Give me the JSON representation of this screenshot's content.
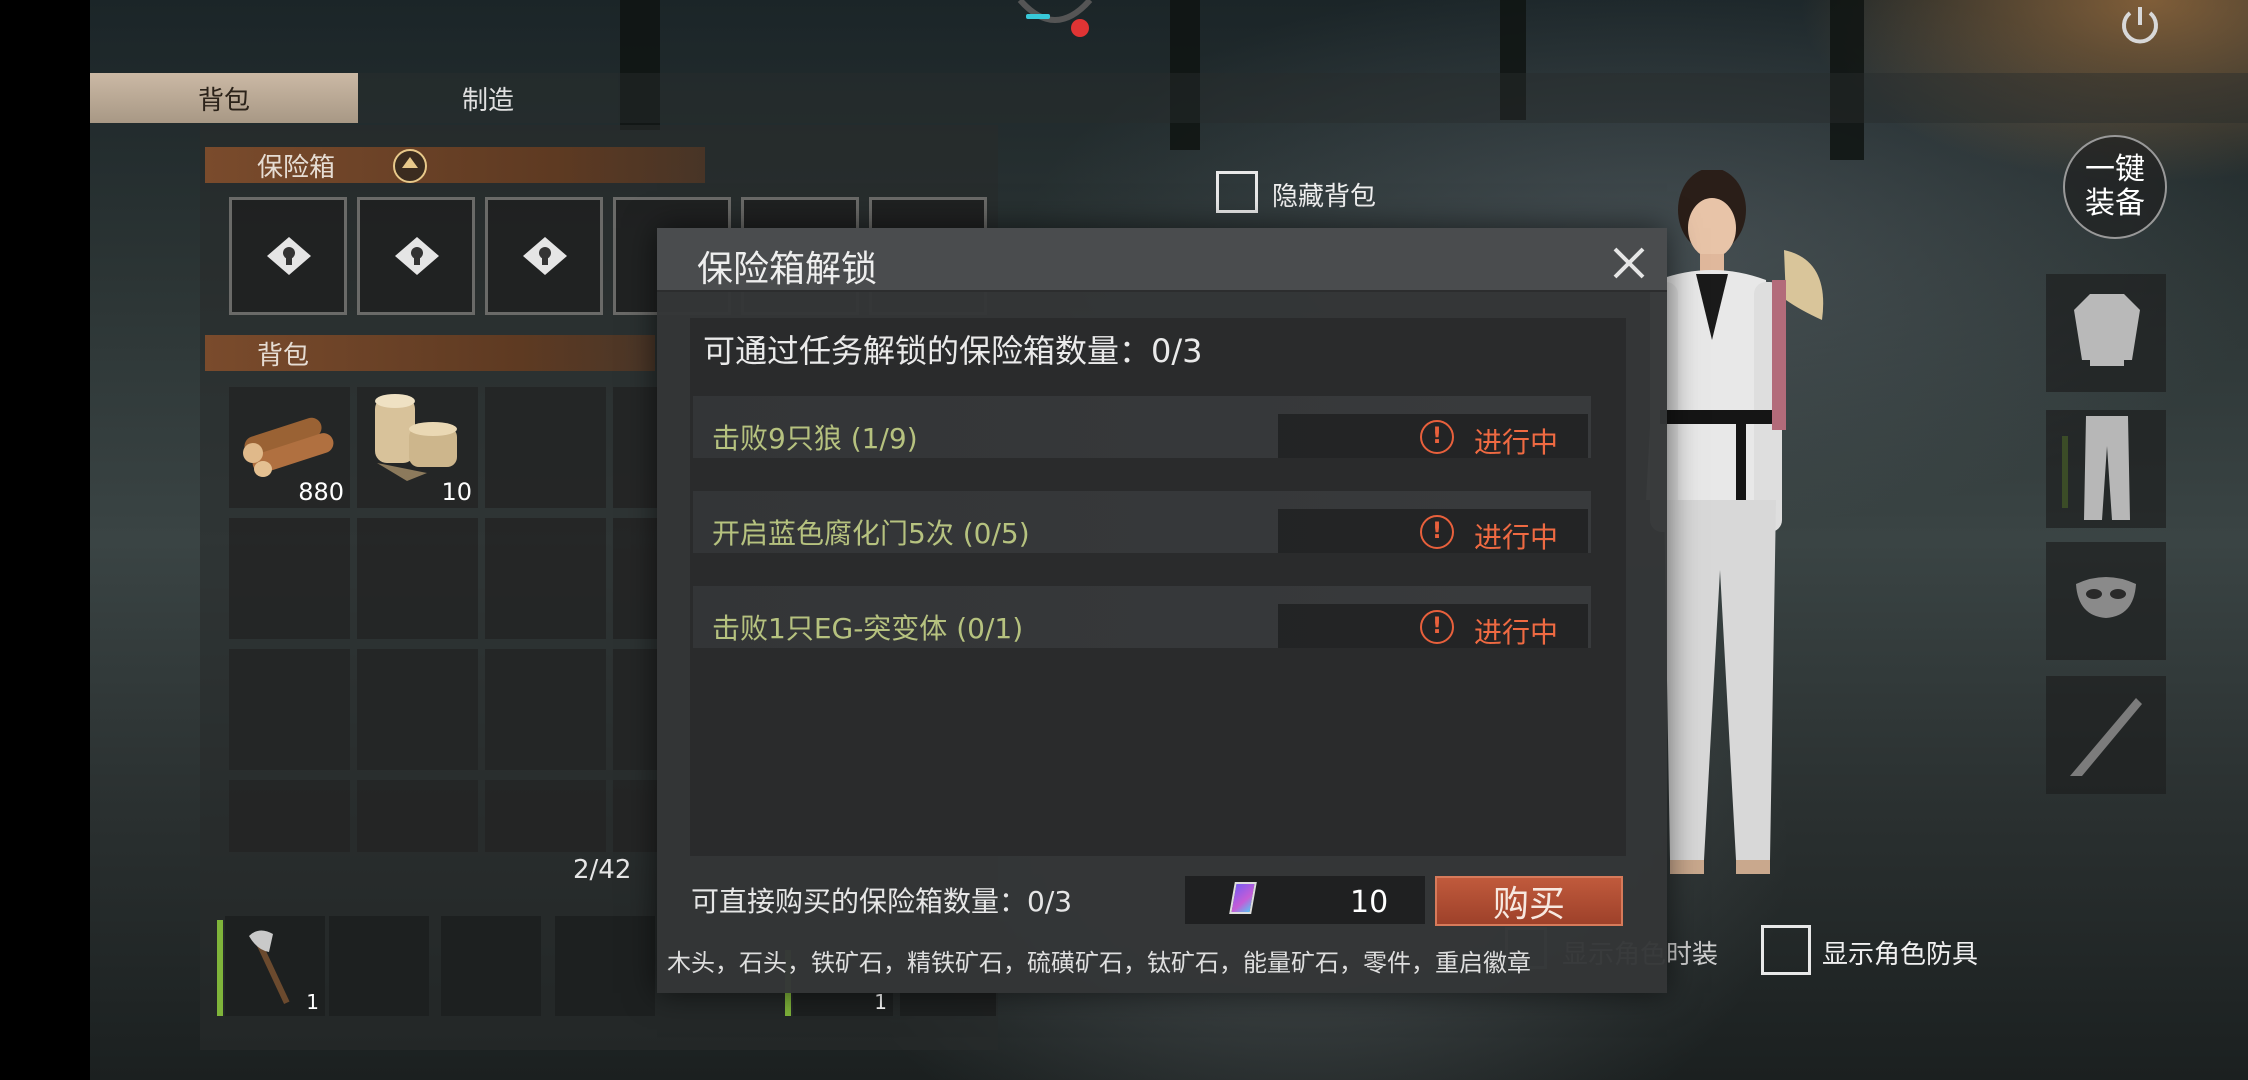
{
  "tabs": {
    "bag": "背包",
    "craft": "制造"
  },
  "left_panel": {
    "safebox_section": "保险箱",
    "bag_section": "背包",
    "items": [
      {
        "icon": "wood-logs-icon",
        "count": "880"
      },
      {
        "icon": "bandage-roll-icon",
        "count": "10"
      }
    ],
    "capacity": "2/42",
    "hotbar": [
      {
        "icon": "axe-icon",
        "count": "1"
      },
      {
        "icon": "item-icon",
        "count": "1"
      }
    ]
  },
  "hide_backpack": {
    "label": "隐藏背包"
  },
  "one_key_equip": {
    "line1": "一键",
    "line2": "装备"
  },
  "show_costume": {
    "label": "显示角色时装"
  },
  "show_armor": {
    "label": "显示角色防具"
  },
  "modal": {
    "title": "保险箱解锁",
    "quest_unlock_count": "可通过任务解锁的保险箱数量：0/3",
    "tasks": [
      {
        "name": "击败9只狼 (1/9)",
        "status": "进行中",
        "progress": 0.111
      },
      {
        "name": "开启蓝色腐化门5次 (0/5)",
        "status": "进行中",
        "progress": 0
      },
      {
        "name": "击败1只EG-突变体 (0/1)",
        "status": "进行中",
        "progress": 0
      }
    ],
    "buy_count": "可直接购买的保险箱数量：0/3",
    "price": "10",
    "buy_button": "购买",
    "materials": "木头，石头，铁矿石，精铁矿石，硫磺矿石，钛矿石，能量矿石，零件，重启徽章"
  },
  "colors": {
    "accent_orange": "#ef6a42",
    "task_green": "#b6c27f",
    "section_brown": "#7a4b2c",
    "buy_red": "#b04d33"
  }
}
